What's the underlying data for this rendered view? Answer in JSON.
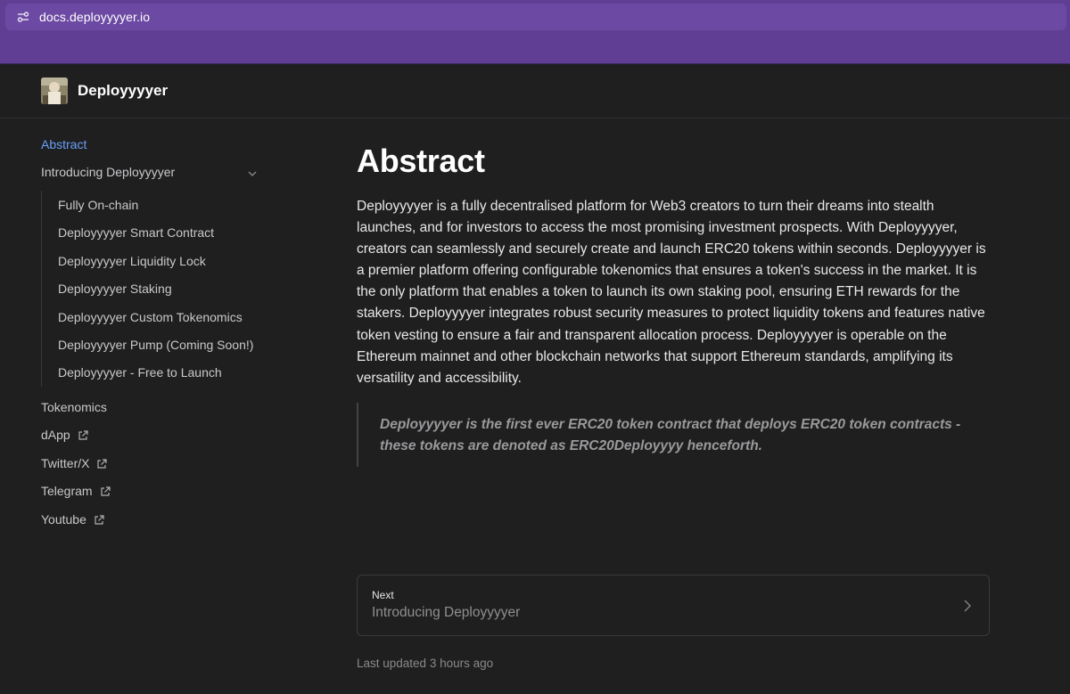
{
  "browser": {
    "url": "docs.deployyyyer.io"
  },
  "site": {
    "title": "Deployyyyer"
  },
  "sidebar": {
    "items": [
      {
        "label": "Abstract"
      },
      {
        "label": "Introducing Deployyyyer"
      },
      {
        "label": "Tokenomics"
      },
      {
        "label": "dApp"
      },
      {
        "label": "Twitter/X"
      },
      {
        "label": "Telegram"
      },
      {
        "label": "Youtube"
      }
    ],
    "subitems": [
      {
        "label": "Fully On-chain"
      },
      {
        "label": "Deployyyyer Smart Contract"
      },
      {
        "label": "Deployyyyer Liquidity Lock"
      },
      {
        "label": "Deployyyyer Staking"
      },
      {
        "label": "Deployyyyer Custom Tokenomics"
      },
      {
        "label": "Deployyyyer Pump (Coming Soon!)"
      },
      {
        "label": "Deployyyyer - Free to Launch"
      }
    ]
  },
  "main": {
    "title": "Abstract",
    "body": "Deployyyyer is a fully decentralised platform for Web3 creators to turn their dreams into stealth launches, and for investors to access the most promising investment prospects. With Deployyyyer, creators can seamlessly and securely create and launch ERC20 tokens within seconds.  Deployyyyer is a premier platform offering configurable tokenomics that ensures a token's success in the market. It is the only platform that enables a token to launch its own staking pool, ensuring ETH rewards for the stakers. Deployyyyer integrates robust security measures to protect liquidity tokens and features native token vesting to ensure a fair and transparent allocation process. Deployyyyer is operable on the Ethereum mainnet and other blockchain networks that support Ethereum standards, amplifying its versatility and accessibility.",
    "quote": "Deployyyyer is the first ever ERC20 token contract that deploys ERC20 token contracts - these tokens are denoted as ERC20Deployyyy henceforth."
  },
  "next": {
    "label": "Next",
    "title": "Introducing Deployyyyer"
  },
  "footer": {
    "updated": "Last updated 3 hours ago"
  },
  "colors": {
    "accent": "#6aa0f5",
    "browser_bar": "#5f3e93",
    "background": "#1f1f20"
  }
}
